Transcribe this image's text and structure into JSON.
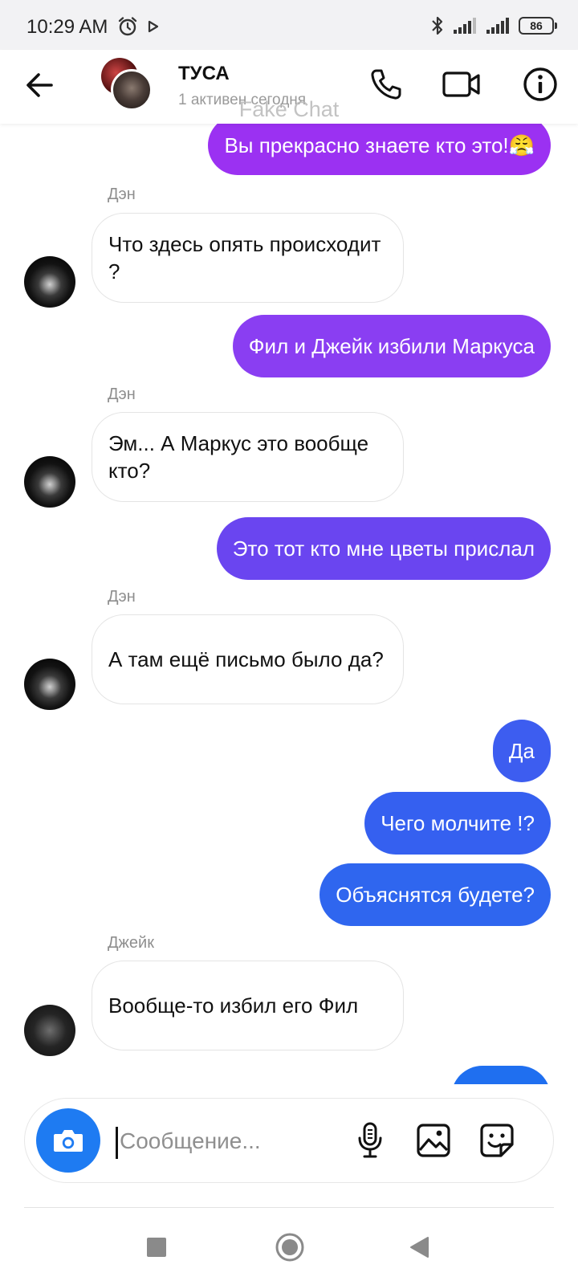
{
  "status_bar": {
    "time": "10:29 AM",
    "battery": "86",
    "icons": [
      "alarm-icon",
      "play-icon",
      "bluetooth-icon",
      "signal-icon",
      "battery-icon"
    ]
  },
  "header": {
    "title": "ТУСА",
    "subtitle": "1 активен сегодня",
    "watermark": "Fake Chat",
    "icons": [
      "back-arrow-icon",
      "phone-icon",
      "video-camera-icon",
      "info-icon"
    ]
  },
  "messages": [
    {
      "side": "out",
      "text": "Вы прекрасно знаете кто это!😤",
      "color": "#9b31f2"
    },
    {
      "side": "in",
      "sender": "Дэн",
      "text": "Что здесь опять происходит ?"
    },
    {
      "side": "out",
      "text": "Фил и Джейк избили Маркуса",
      "color": "#8a3ef2"
    },
    {
      "side": "in",
      "sender": "Дэн",
      "text": "Эм... А Маркус это вообще кто?"
    },
    {
      "side": "out",
      "text": "Это тот кто мне цветы прислал",
      "color": "#6a45f0"
    },
    {
      "side": "in",
      "sender": "Дэн",
      "text": "А там ещё письмо было да?"
    },
    {
      "side": "out",
      "text": "Да",
      "color": "#3d5df0"
    },
    {
      "side": "out",
      "text": "Чего молчите !?",
      "color": "#3560f0"
    },
    {
      "side": "out",
      "text": "Объяснятся будете?",
      "color": "#2f66ef"
    },
    {
      "side": "in",
      "sender": "Джейк",
      "text": "Вообще-то избил его Фил"
    }
  ],
  "input": {
    "placeholder": "Сообщение...",
    "value": ""
  },
  "colors": {
    "accent": "#1e7bf2",
    "incoming_border": "#e4e4e4",
    "sender_text": "#8e8e8e"
  },
  "navbar": {
    "icons": [
      "recents-square-icon",
      "home-circle-icon",
      "back-triangle-icon"
    ]
  }
}
